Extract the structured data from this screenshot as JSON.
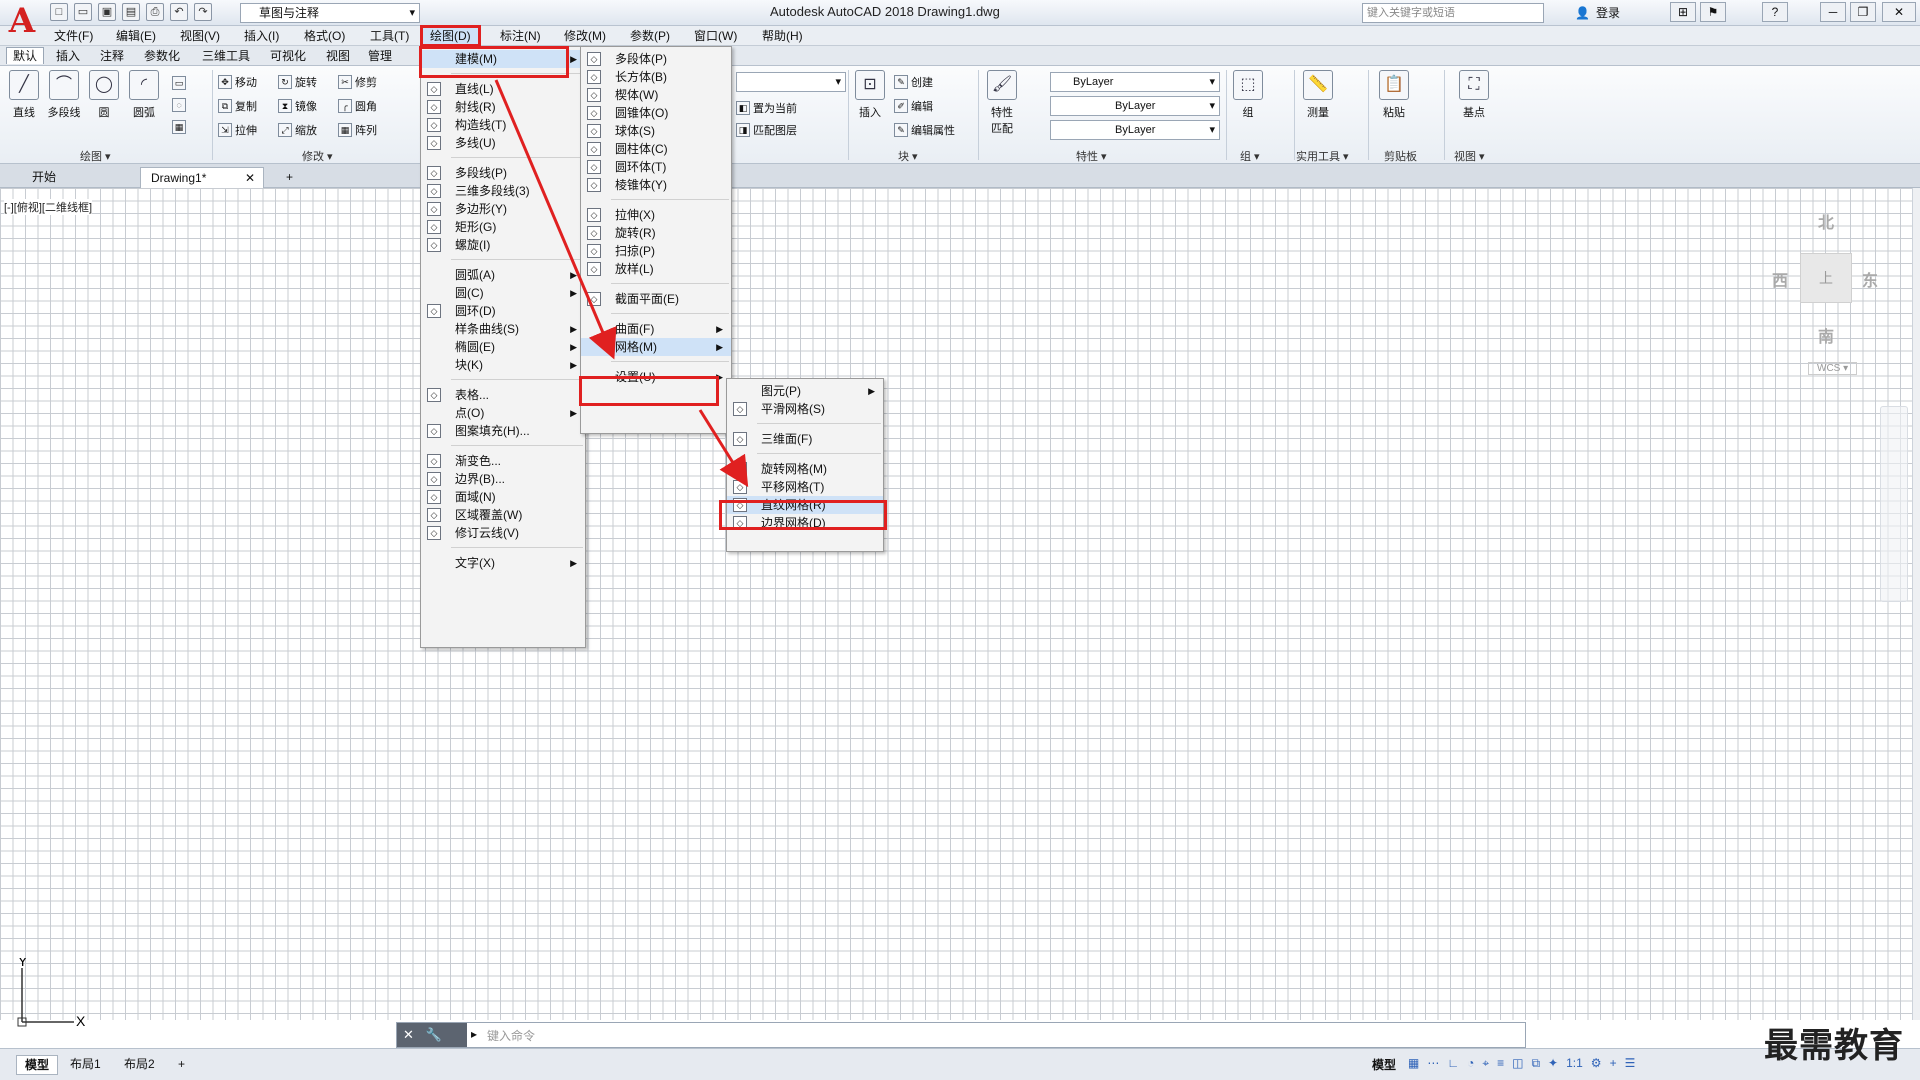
{
  "app": {
    "title": "Autodesk AutoCAD 2018    Drawing1.dwg",
    "logo": "A",
    "workspace": "草图与注释",
    "search_placeholder": "键入关键字或短语",
    "login": "登录",
    "help": "?"
  },
  "menubar": [
    "文件(F)",
    "编辑(E)",
    "视图(V)",
    "插入(I)",
    "格式(O)",
    "工具(T)",
    "绘图(D)",
    "标注(N)",
    "修改(M)",
    "参数(P)",
    "窗口(W)",
    "帮助(H)"
  ],
  "ribbon_tabs": [
    "默认",
    "插入",
    "注释",
    "参数化",
    "三维工具",
    "可视化",
    "视图",
    "管理"
  ],
  "ribbon": {
    "draw": {
      "line": "直线",
      "polyline": "多段线",
      "circle": "圆",
      "arc": "圆弧",
      "title": "绘图 ▾"
    },
    "modify": {
      "move": "移动",
      "rotate": "旋转",
      "trim": "修剪",
      "copy": "复制",
      "mirror": "镜像",
      "fillet": "圆角",
      "stretch": "拉伸",
      "scale": "缩放",
      "array": "阵列",
      "title": "修改 ▾"
    },
    "layers": {
      "set_current": "置为当前",
      "match_layer": "匹配图层"
    },
    "block": {
      "insert": "插入",
      "create": "创建",
      "edit": "编辑",
      "edit_attr": "编辑属性",
      "title": "块 ▾"
    },
    "properties": {
      "match": "特性\n匹配",
      "color": "ByLayer",
      "linetype": "ByLayer",
      "lineweight": "ByLayer",
      "title": "特性 ▾"
    },
    "group": {
      "group": "组",
      "title": "组 ▾"
    },
    "utilities": {
      "measure": "测量",
      "title": "实用工具 ▾"
    },
    "clipboard": {
      "paste": "粘贴",
      "title": "剪贴板"
    },
    "view": {
      "base": "基点",
      "title": "视图 ▾"
    }
  },
  "doc_tabs": [
    "开始",
    "Drawing1*",
    "+"
  ],
  "viewport_label": "[-][俯视][二维线框]",
  "viewcube": {
    "north": "北",
    "south": "南",
    "east": "东",
    "west": "西",
    "top": "上",
    "wcs": "WCS ▾"
  },
  "ucs": {
    "x": "X",
    "y": "Y"
  },
  "draw_menu": [
    {
      "label": "建模(M)",
      "icon": "",
      "arrow": true
    },
    {
      "label": "直线(L)",
      "icon": "line-icon"
    },
    {
      "label": "射线(R)",
      "icon": "ray-icon"
    },
    {
      "label": "构造线(T)",
      "icon": "xline-icon"
    },
    {
      "label": "多线(U)",
      "icon": "mline-icon"
    },
    {
      "label": "多段线(P)",
      "icon": "polyline-icon"
    },
    {
      "label": "三维多段线(3)",
      "icon": "3dpoly-icon"
    },
    {
      "label": "多边形(Y)",
      "icon": "polygon-icon"
    },
    {
      "label": "矩形(G)",
      "icon": "rectangle-icon"
    },
    {
      "label": "螺旋(I)",
      "icon": "helix-icon"
    },
    {
      "label": "圆弧(A)",
      "icon": "",
      "arrow": true
    },
    {
      "label": "圆(C)",
      "icon": "",
      "arrow": true
    },
    {
      "label": "圆环(D)",
      "icon": "donut-icon"
    },
    {
      "label": "样条曲线(S)",
      "icon": "",
      "arrow": true
    },
    {
      "label": "椭圆(E)",
      "icon": "",
      "arrow": true
    },
    {
      "label": "块(K)",
      "icon": "",
      "arrow": true
    },
    {
      "label": "表格...",
      "icon": "table-icon"
    },
    {
      "label": "点(O)",
      "icon": "",
      "arrow": true
    },
    {
      "label": "图案填充(H)...",
      "icon": "hatch-icon"
    },
    {
      "label": "渐变色...",
      "icon": "gradient-icon"
    },
    {
      "label": "边界(B)...",
      "icon": "boundary-icon"
    },
    {
      "label": "面域(N)",
      "icon": "region-icon"
    },
    {
      "label": "区域覆盖(W)",
      "icon": "wipeout-icon"
    },
    {
      "label": "修订云线(V)",
      "icon": "revcloud-icon"
    },
    {
      "label": "文字(X)",
      "icon": "",
      "arrow": true
    }
  ],
  "modeling_menu": [
    {
      "label": "多段体(P)",
      "icon": "polysolid-icon"
    },
    {
      "label": "长方体(B)",
      "icon": "box-icon"
    },
    {
      "label": "楔体(W)",
      "icon": "wedge-icon"
    },
    {
      "label": "圆锥体(O)",
      "icon": "cone-icon"
    },
    {
      "label": "球体(S)",
      "icon": "sphere-icon"
    },
    {
      "label": "圆柱体(C)",
      "icon": "cylinder-icon"
    },
    {
      "label": "圆环体(T)",
      "icon": "torus-icon"
    },
    {
      "label": "棱锥体(Y)",
      "icon": "pyramid-icon"
    },
    {
      "label": "拉伸(X)",
      "icon": "extrude-icon"
    },
    {
      "label": "旋转(R)",
      "icon": "revolve-icon"
    },
    {
      "label": "扫掠(P)",
      "icon": "sweep-icon"
    },
    {
      "label": "放样(L)",
      "icon": "loft-icon"
    },
    {
      "label": "截面平面(E)",
      "icon": "section-plane-icon"
    },
    {
      "label": "曲面(F)",
      "icon": "",
      "arrow": true
    },
    {
      "label": "网格(M)",
      "icon": "",
      "arrow": true
    },
    {
      "label": "设置(U)",
      "icon": "",
      "arrow": true
    }
  ],
  "mesh_menu": [
    {
      "label": "图元(P)",
      "icon": "",
      "arrow": true
    },
    {
      "label": "平滑网格(S)",
      "icon": "smooth-mesh-icon"
    },
    {
      "label": "三维面(F)",
      "icon": "3dface-icon"
    },
    {
      "label": "旋转网格(M)",
      "icon": "revsurf-icon"
    },
    {
      "label": "平移网格(T)",
      "icon": "tabsurf-icon"
    },
    {
      "label": "直纹网格(R)",
      "icon": "rulesurf-icon"
    },
    {
      "label": "边界网格(D)",
      "icon": "edgesurf-icon"
    }
  ],
  "command_line": {
    "placeholder": "键入命令",
    "tools": "✕ 🔧"
  },
  "status_tabs": [
    "模型",
    "布局1",
    "布局2",
    "+"
  ],
  "status": {
    "model": "模型",
    "scale": "1:1"
  },
  "watermark": "最需教育"
}
